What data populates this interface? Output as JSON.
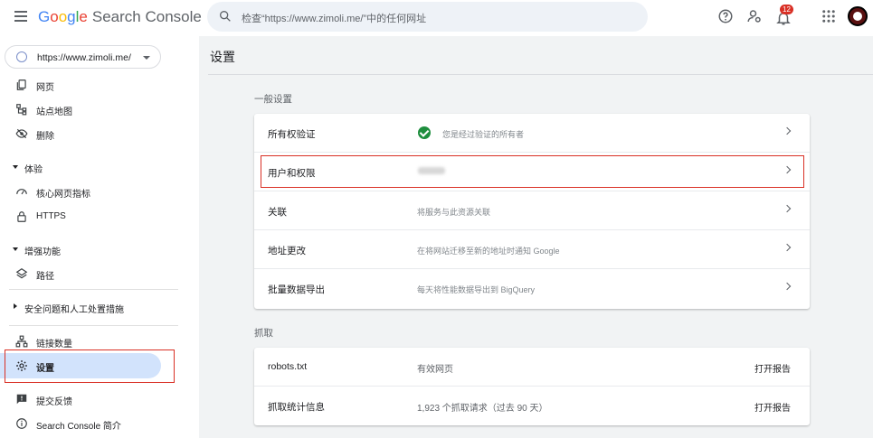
{
  "header": {
    "logo_letters": [
      "G",
      "o",
      "o",
      "g",
      "l",
      "e"
    ],
    "product": "Search Console",
    "search_placeholder": "检查“https://www.zimoli.me/”中的任何网址",
    "notification_count": "12"
  },
  "sidebar": {
    "property": "https://www.zimoli.me/",
    "items": [
      {
        "label": "网页"
      },
      {
        "label": "站点地图"
      },
      {
        "label": "删除"
      }
    ],
    "section_experience": "体验",
    "experience_items": [
      {
        "label": "核心网页指标"
      },
      {
        "label": "HTTPS"
      }
    ],
    "section_enhancements": "增强功能",
    "enhancement_items": [
      {
        "label": "路径"
      }
    ],
    "section_security": "安全问题和人工处置措施",
    "links_label": "链接数量",
    "settings_label": "设置",
    "feedback_label": "提交反馈",
    "about_label": "Search Console 简介"
  },
  "main": {
    "title": "设置",
    "general_label": "一般设置",
    "general_rows": [
      {
        "name": "所有权验证",
        "desc": "您是经过验证的所有者"
      },
      {
        "name": "用户和权限",
        "desc": ""
      },
      {
        "name": "关联",
        "desc": "将服务与此资源关联"
      },
      {
        "name": "地址更改",
        "desc": "在将网站迁移至新的地址时通知 Google"
      },
      {
        "name": "批量数据导出",
        "desc": "每天将性能数据导出到 BigQuery"
      }
    ],
    "crawl_label": "抓取",
    "crawl_rows": [
      {
        "name": "robots.txt",
        "desc": "有效网页",
        "action": "打开报告"
      },
      {
        "name": "抓取统计信息",
        "desc": "1,923 个抓取请求（过去 90 天）",
        "action": "打开报告"
      }
    ]
  },
  "colors": {
    "accent": "#1a73e8",
    "active_bg": "#d2e3fc",
    "highlight_red": "#d93025",
    "success_green": "#1e8e3e"
  }
}
